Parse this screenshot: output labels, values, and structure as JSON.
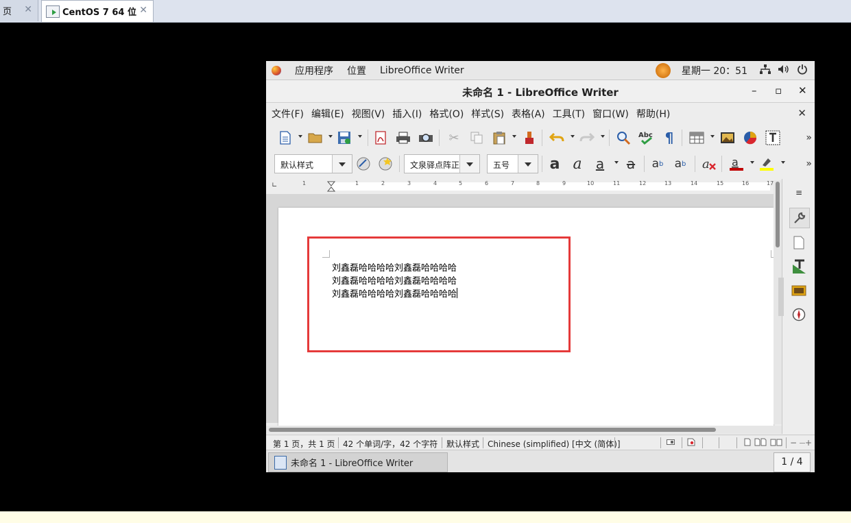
{
  "host_tabs": [
    {
      "label": "主页",
      "visible_label": "页",
      "close": "✕"
    },
    {
      "label": "CentOS 7 64 位",
      "close": "✕"
    }
  ],
  "top_panel": {
    "applications": "应用程序",
    "places": "位置",
    "active_app": "LibreOffice Writer",
    "clock": "星期一 20：51"
  },
  "window": {
    "title": "未命名 1 - LibreOffice Writer",
    "min": "–",
    "max": "▫",
    "close": "✕"
  },
  "menu": {
    "items": [
      "文件(F)",
      "编辑(E)",
      "视图(V)",
      "插入(I)",
      "格式(O)",
      "样式(S)",
      "表格(A)",
      "工具(T)",
      "窗口(W)",
      "帮助(H)"
    ],
    "close": "✕"
  },
  "formatting": {
    "paragraph_style": "默认样式",
    "font_name": "文泉驿点阵正黑",
    "font_size": "五号"
  },
  "ruler": {
    "ticks": [
      "1",
      "1",
      "2",
      "3",
      "4",
      "5",
      "6",
      "7",
      "8",
      "9",
      "10",
      "11",
      "12",
      "13",
      "14",
      "15",
      "16",
      "17"
    ]
  },
  "document": {
    "lines": [
      "刘鑫磊哈哈哈哈刘鑫磊哈哈哈哈",
      "刘鑫磊哈哈哈哈刘鑫磊哈哈哈哈",
      "刘鑫磊哈哈哈哈刘鑫磊哈哈哈哈"
    ]
  },
  "status": {
    "page": "第 1 页，共 1 页",
    "words": "42 个单词/字，42 个字符",
    "page_style": "默认样式",
    "language": "Chinese (simplified) [中文 (简体)]"
  },
  "taskbar": {
    "task": "未命名 1 - LibreOffice Writer",
    "workspace": "1 / 4"
  },
  "annotation": {
    "color": "#e53a3a"
  }
}
